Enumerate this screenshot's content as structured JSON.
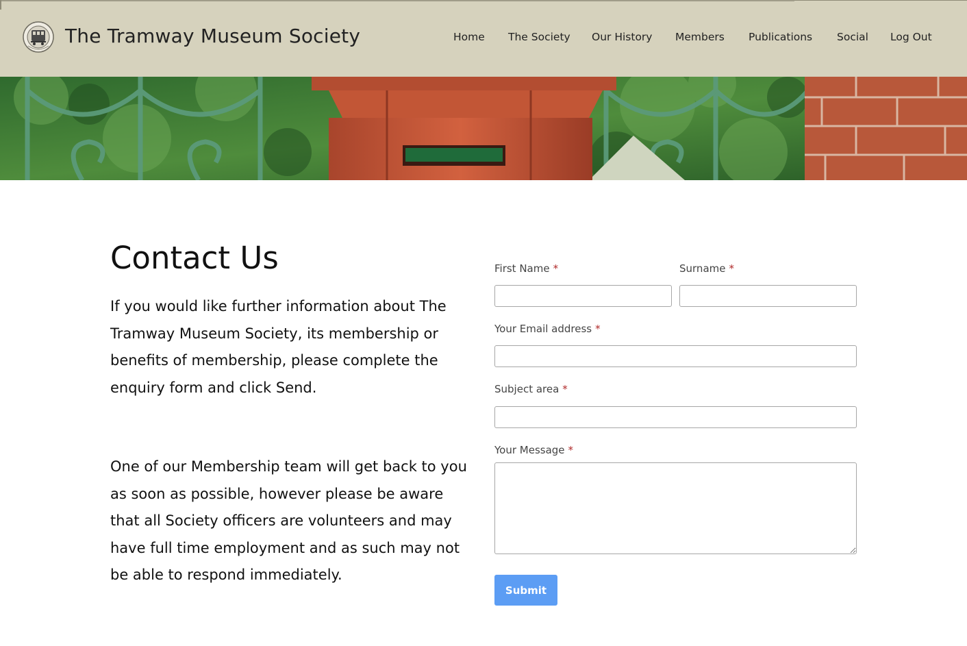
{
  "header": {
    "site_title": "The Tramway Museum Society",
    "logo_icon": "society-seal-icon",
    "nav": [
      {
        "label": "Home"
      },
      {
        "label": "The Society"
      },
      {
        "label": "Our History"
      },
      {
        "label": "Members"
      },
      {
        "label": "Publications"
      },
      {
        "label": "Social"
      },
      {
        "label": "Log Out"
      }
    ]
  },
  "banner": {
    "image_icon": "postbox-banner-image"
  },
  "main": {
    "title": "Contact Us",
    "paragraphs": [
      "If you would like further information about The Tramway Museum Society, its membership or benefits of membership, please complete the enquiry form and click Send.",
      "One of our Membership team will get back to you as soon as possible, however please be aware that all Society officers are volunteers and may have full time employment and as such may not be able to respond immediately."
    ]
  },
  "form": {
    "required_marker": "*",
    "first_name": {
      "label": "First Name",
      "value": ""
    },
    "surname": {
      "label": "Surname",
      "value": ""
    },
    "email": {
      "label": "Your Email address",
      "value": ""
    },
    "subject": {
      "label": "Subject area",
      "value": ""
    },
    "message": {
      "label": "Your Message",
      "value": ""
    },
    "submit_label": "Submit"
  },
  "colors": {
    "header_bg": "#d6d2bd",
    "submit_bg": "#5c9df4",
    "required": "#b02a2a"
  }
}
